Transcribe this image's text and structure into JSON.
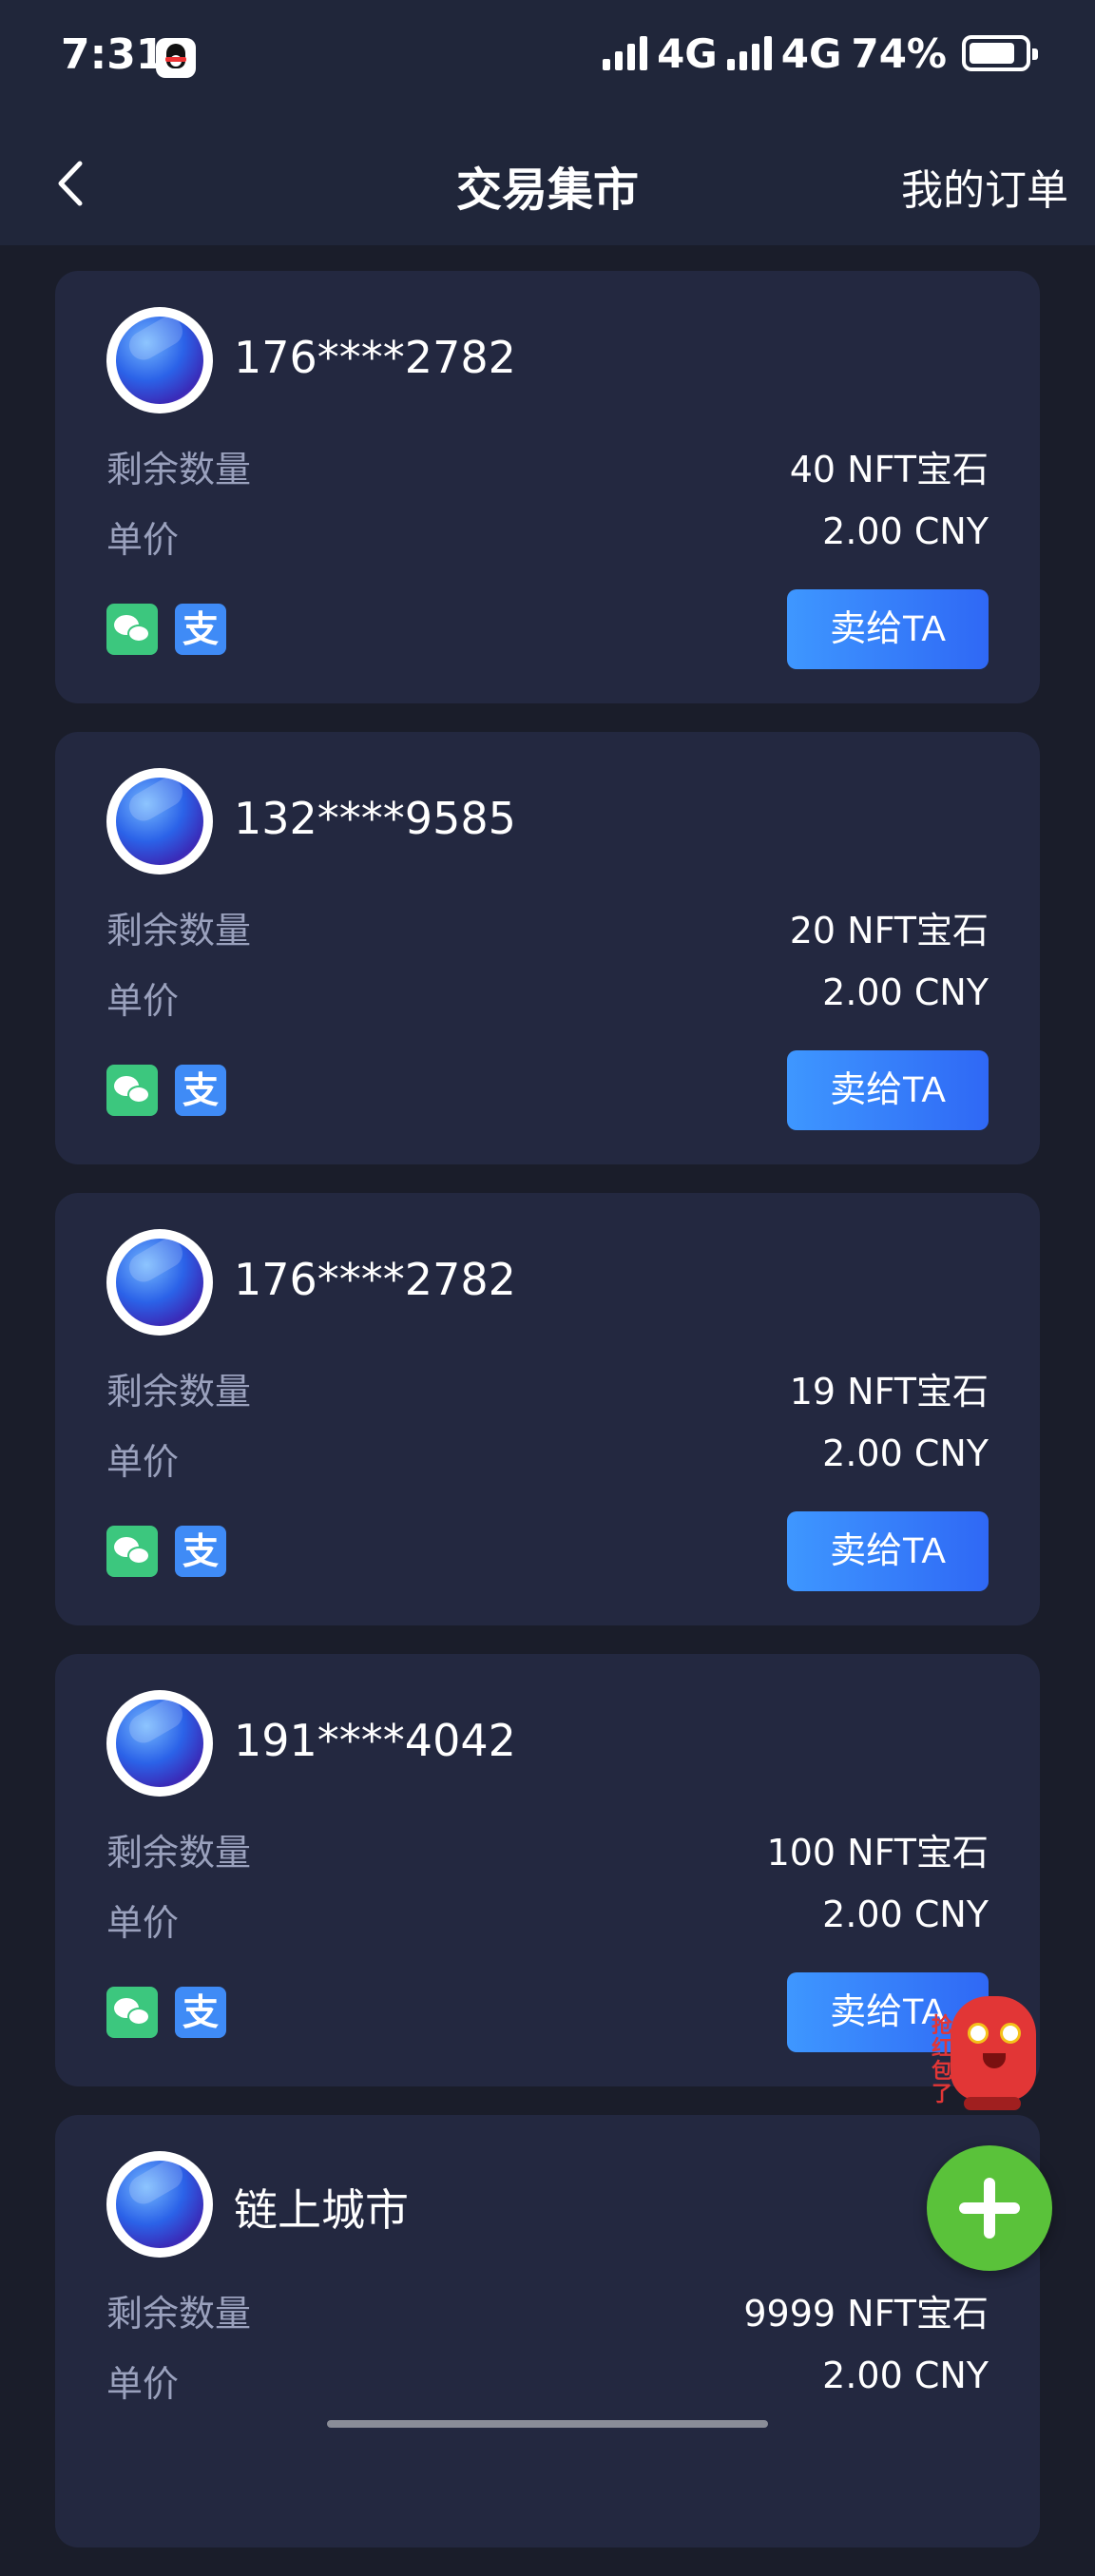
{
  "status_bar": {
    "time": "7:31",
    "network1": "4G",
    "network2": "4G",
    "battery": "74%",
    "battery_level": 0.74
  },
  "nav": {
    "title": "交易集市",
    "action": "我的订单"
  },
  "labels": {
    "remaining": "剩余数量",
    "unit_price": "单价",
    "sell_button": "卖给TA",
    "alipay_glyph": "支"
  },
  "listings": [
    {
      "seller": "176****2782",
      "remaining": "40 NFT宝石",
      "price": "2.00 CNY"
    },
    {
      "seller": "132****9585",
      "remaining": "20 NFT宝石",
      "price": "2.00 CNY"
    },
    {
      "seller": "176****2782",
      "remaining": "19 NFT宝石",
      "price": "2.00 CNY"
    },
    {
      "seller": "191****4042",
      "remaining": "100 NFT宝石",
      "price": "2.00 CNY"
    },
    {
      "seller": "链上城市",
      "remaining": "9999 NFT宝石",
      "price": "2.00 CNY"
    }
  ],
  "mascot": {
    "text": "抢红包了"
  },
  "colors": {
    "background": "#1a1d2a",
    "card": "#232840",
    "accent": "#3e97ff",
    "fab": "#5ac23a"
  }
}
